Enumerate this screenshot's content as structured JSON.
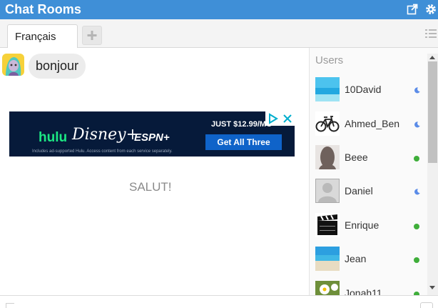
{
  "header": {
    "title": "Chat Rooms",
    "icons": [
      "external-link-icon",
      "gear-icon"
    ],
    "bg_color": "#3f8fd7"
  },
  "tabs": {
    "items": [
      {
        "label": "Français",
        "active": true
      }
    ],
    "add_label": "+"
  },
  "chat": {
    "messages": [
      {
        "text": "bonjour",
        "avatar": "cartoon-avatar"
      }
    ],
    "ad": {
      "brand1": "hulu",
      "brand2": "Disney+",
      "brand3": "ESPN+",
      "price": "JUST $12.99/MO",
      "cta": "Get All Three",
      "fine_print": "Includes ad-supported Hulu. Access content from each service separately."
    },
    "system_text": "SALUT!"
  },
  "users": {
    "title": "Users",
    "list": [
      {
        "name": "10David",
        "status": "away",
        "avatar": "beach-photo"
      },
      {
        "name": "Ahmed_Ben",
        "status": "away",
        "avatar": "bicycle-photo"
      },
      {
        "name": "Beee",
        "status": "online",
        "avatar": "silhouette-dark"
      },
      {
        "name": "Daniel",
        "status": "away",
        "avatar": "default-silhouette"
      },
      {
        "name": "Enrique",
        "status": "online",
        "avatar": "clapperboard"
      },
      {
        "name": "Jean",
        "status": "online",
        "avatar": "beach-photo"
      },
      {
        "name": "Jonah11",
        "status": "online",
        "avatar": "daisy-photo"
      }
    ],
    "status_colors": {
      "online": "#3fae3a",
      "away": "#5b8ce8"
    }
  },
  "composer": {
    "placeholder": ""
  }
}
